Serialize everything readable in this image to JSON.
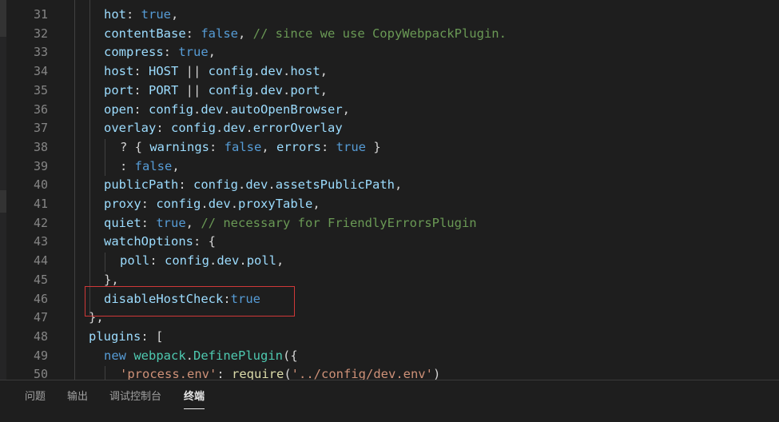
{
  "editor": {
    "lines": [
      {
        "number": "31",
        "tokens": [
          {
            "t": "hot",
            "c": "prop"
          },
          {
            "t": ": ",
            "c": "punc"
          },
          {
            "t": "true",
            "c": "kw"
          },
          {
            "t": ",",
            "c": "punc"
          }
        ]
      },
      {
        "number": "32",
        "tokens": [
          {
            "t": "contentBase",
            "c": "prop"
          },
          {
            "t": ": ",
            "c": "punc"
          },
          {
            "t": "false",
            "c": "kw"
          },
          {
            "t": ", ",
            "c": "punc"
          },
          {
            "t": "// since we use CopyWebpackPlugin.",
            "c": "cmt"
          }
        ]
      },
      {
        "number": "33",
        "tokens": [
          {
            "t": "compress",
            "c": "prop"
          },
          {
            "t": ": ",
            "c": "punc"
          },
          {
            "t": "true",
            "c": "kw"
          },
          {
            "t": ",",
            "c": "punc"
          }
        ]
      },
      {
        "number": "34",
        "tokens": [
          {
            "t": "host",
            "c": "prop"
          },
          {
            "t": ": ",
            "c": "punc"
          },
          {
            "t": "HOST",
            "c": "prop"
          },
          {
            "t": " || ",
            "c": "punc"
          },
          {
            "t": "config",
            "c": "prop"
          },
          {
            "t": ".",
            "c": "punc"
          },
          {
            "t": "dev",
            "c": "prop"
          },
          {
            "t": ".",
            "c": "punc"
          },
          {
            "t": "host",
            "c": "prop"
          },
          {
            "t": ",",
            "c": "punc"
          }
        ]
      },
      {
        "number": "35",
        "tokens": [
          {
            "t": "port",
            "c": "prop"
          },
          {
            "t": ": ",
            "c": "punc"
          },
          {
            "t": "PORT",
            "c": "prop"
          },
          {
            "t": " || ",
            "c": "punc"
          },
          {
            "t": "config",
            "c": "prop"
          },
          {
            "t": ".",
            "c": "punc"
          },
          {
            "t": "dev",
            "c": "prop"
          },
          {
            "t": ".",
            "c": "punc"
          },
          {
            "t": "port",
            "c": "prop"
          },
          {
            "t": ",",
            "c": "punc"
          }
        ]
      },
      {
        "number": "36",
        "tokens": [
          {
            "t": "open",
            "c": "prop"
          },
          {
            "t": ": ",
            "c": "punc"
          },
          {
            "t": "config",
            "c": "prop"
          },
          {
            "t": ".",
            "c": "punc"
          },
          {
            "t": "dev",
            "c": "prop"
          },
          {
            "t": ".",
            "c": "punc"
          },
          {
            "t": "autoOpenBrowser",
            "c": "prop"
          },
          {
            "t": ",",
            "c": "punc"
          }
        ]
      },
      {
        "number": "37",
        "tokens": [
          {
            "t": "overlay",
            "c": "prop"
          },
          {
            "t": ": ",
            "c": "punc"
          },
          {
            "t": "config",
            "c": "prop"
          },
          {
            "t": ".",
            "c": "punc"
          },
          {
            "t": "dev",
            "c": "prop"
          },
          {
            "t": ".",
            "c": "punc"
          },
          {
            "t": "errorOverlay",
            "c": "prop"
          }
        ]
      },
      {
        "number": "38",
        "tokens": [
          {
            "t": "? { ",
            "c": "punc"
          },
          {
            "t": "warnings",
            "c": "prop"
          },
          {
            "t": ": ",
            "c": "punc"
          },
          {
            "t": "false",
            "c": "kw"
          },
          {
            "t": ", ",
            "c": "punc"
          },
          {
            "t": "errors",
            "c": "prop"
          },
          {
            "t": ": ",
            "c": "punc"
          },
          {
            "t": "true",
            "c": "kw"
          },
          {
            "t": " }",
            "c": "punc"
          }
        ]
      },
      {
        "number": "39",
        "tokens": [
          {
            "t": ": ",
            "c": "punc"
          },
          {
            "t": "false",
            "c": "kw"
          },
          {
            "t": ",",
            "c": "punc"
          }
        ]
      },
      {
        "number": "40",
        "tokens": [
          {
            "t": "publicPath",
            "c": "prop"
          },
          {
            "t": ": ",
            "c": "punc"
          },
          {
            "t": "config",
            "c": "prop"
          },
          {
            "t": ".",
            "c": "punc"
          },
          {
            "t": "dev",
            "c": "prop"
          },
          {
            "t": ".",
            "c": "punc"
          },
          {
            "t": "assetsPublicPath",
            "c": "prop"
          },
          {
            "t": ",",
            "c": "punc"
          }
        ]
      },
      {
        "number": "41",
        "tokens": [
          {
            "t": "proxy",
            "c": "prop"
          },
          {
            "t": ": ",
            "c": "punc"
          },
          {
            "t": "config",
            "c": "prop"
          },
          {
            "t": ".",
            "c": "punc"
          },
          {
            "t": "dev",
            "c": "prop"
          },
          {
            "t": ".",
            "c": "punc"
          },
          {
            "t": "proxyTable",
            "c": "prop"
          },
          {
            "t": ",",
            "c": "punc"
          }
        ]
      },
      {
        "number": "42",
        "tokens": [
          {
            "t": "quiet",
            "c": "prop"
          },
          {
            "t": ": ",
            "c": "punc"
          },
          {
            "t": "true",
            "c": "kw"
          },
          {
            "t": ", ",
            "c": "punc"
          },
          {
            "t": "// necessary for FriendlyErrorsPlugin",
            "c": "cmt"
          }
        ]
      },
      {
        "number": "43",
        "tokens": [
          {
            "t": "watchOptions",
            "c": "prop"
          },
          {
            "t": ": {",
            "c": "punc"
          }
        ]
      },
      {
        "number": "44",
        "tokens": [
          {
            "t": "poll",
            "c": "prop"
          },
          {
            "t": ": ",
            "c": "punc"
          },
          {
            "t": "config",
            "c": "prop"
          },
          {
            "t": ".",
            "c": "punc"
          },
          {
            "t": "dev",
            "c": "prop"
          },
          {
            "t": ".",
            "c": "punc"
          },
          {
            "t": "poll",
            "c": "prop"
          },
          {
            "t": ",",
            "c": "punc"
          }
        ]
      },
      {
        "number": "45",
        "tokens": [
          {
            "t": "},",
            "c": "punc"
          }
        ]
      },
      {
        "number": "46",
        "tokens": [
          {
            "t": "disableHostCheck",
            "c": "prop"
          },
          {
            "t": ":",
            "c": "punc"
          },
          {
            "t": "true",
            "c": "kw"
          }
        ]
      },
      {
        "number": "47",
        "tokens": [
          {
            "t": "},",
            "c": "punc"
          }
        ]
      },
      {
        "number": "48",
        "tokens": [
          {
            "t": "plugins",
            "c": "prop"
          },
          {
            "t": ": [",
            "c": "punc"
          }
        ]
      },
      {
        "number": "49",
        "tokens": [
          {
            "t": "new ",
            "c": "kw"
          },
          {
            "t": "webpack",
            "c": "cls"
          },
          {
            "t": ".",
            "c": "punc"
          },
          {
            "t": "DefinePlugin",
            "c": "cls"
          },
          {
            "t": "({",
            "c": "punc"
          }
        ]
      },
      {
        "number": "50",
        "tokens": [
          {
            "t": "'process.env'",
            "c": "str"
          },
          {
            "t": ": ",
            "c": "punc"
          },
          {
            "t": "require",
            "c": "fn"
          },
          {
            "t": "(",
            "c": "punc"
          },
          {
            "t": "'../config/dev.env'",
            "c": "str"
          },
          {
            "t": ")",
            "c": "punc"
          }
        ]
      }
    ]
  },
  "panel": {
    "tabs": [
      {
        "label": "问题",
        "active": false
      },
      {
        "label": "输出",
        "active": false
      },
      {
        "label": "调试控制台",
        "active": false
      },
      {
        "label": "终端",
        "active": true
      }
    ]
  },
  "colors": {
    "background": "#1e1e1e",
    "property": "#9cdcfe",
    "keyword": "#569cd6",
    "comment": "#6a9955",
    "string": "#ce9178",
    "class": "#4ec9b0",
    "function": "#dcdcaa",
    "line_number": "#858585",
    "highlight_box": "#d03838"
  }
}
